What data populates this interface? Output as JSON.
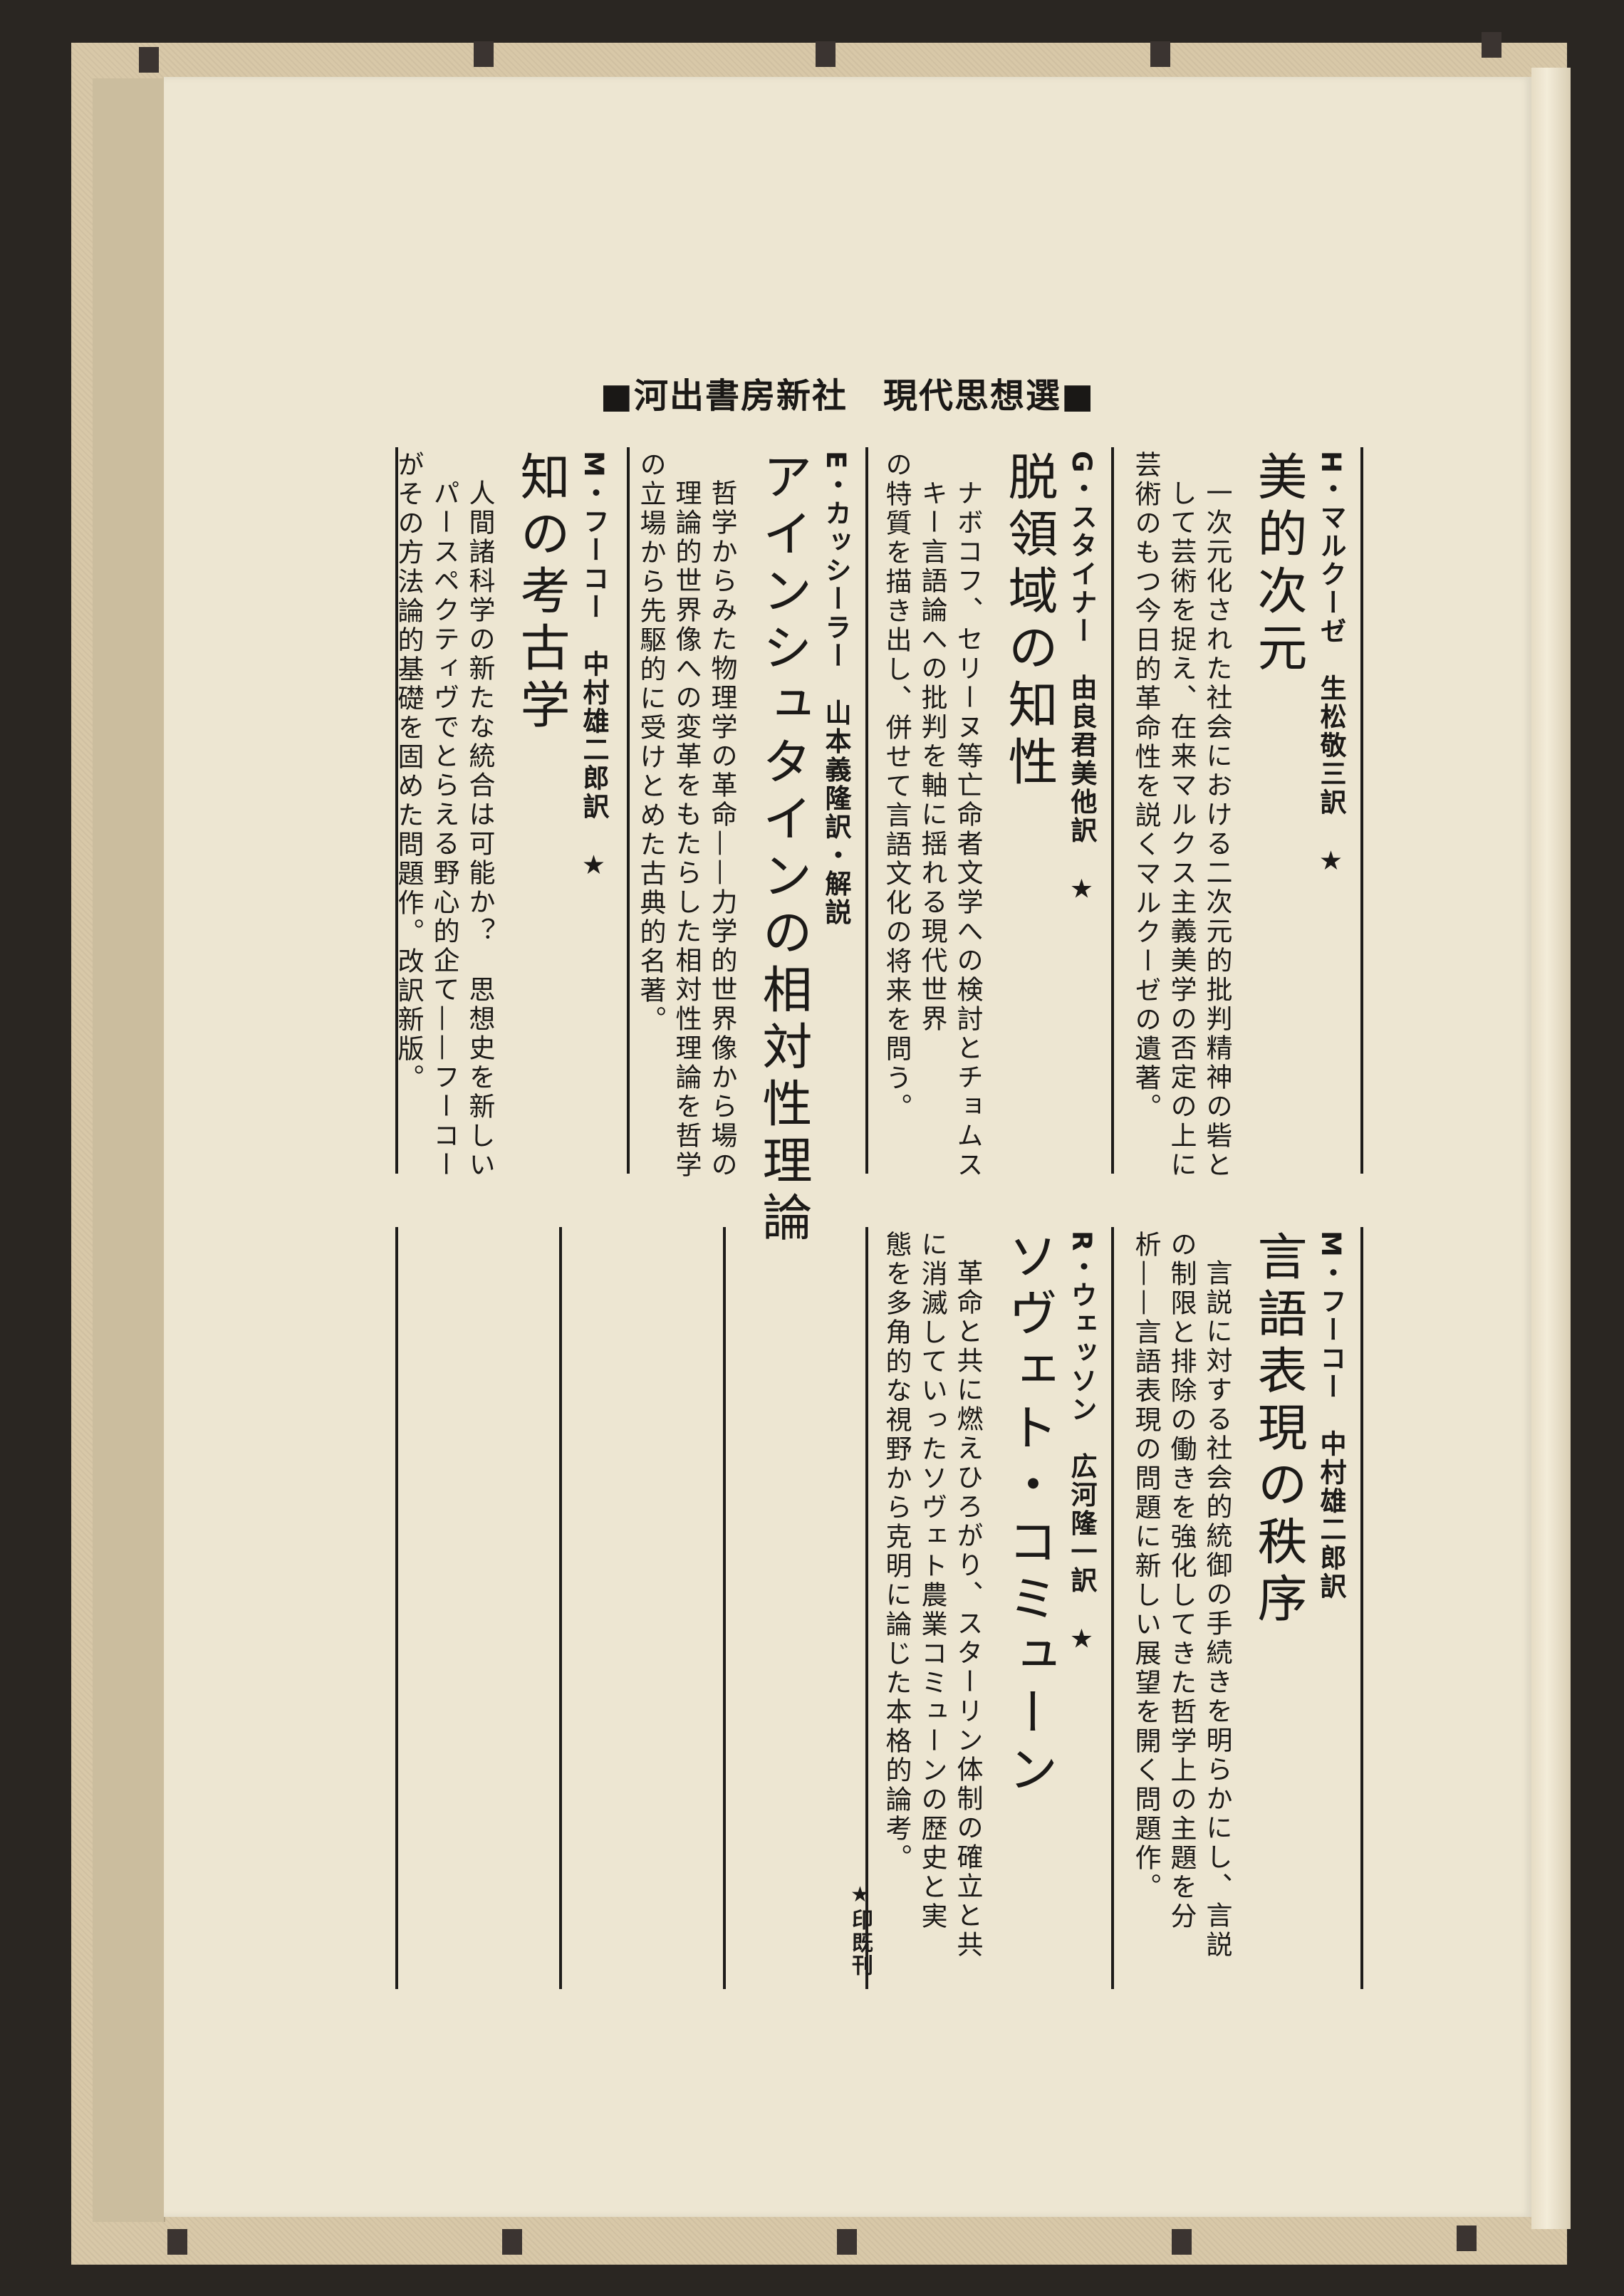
{
  "header": "■河出書房新社　現代思想選■",
  "books": [
    {
      "author": "H・マルクーゼ　生松敬三訳　★",
      "title": "美的次元",
      "desc": [
        "一次元化された社会における二次元的批判精神の砦と",
        "して芸術を捉え、在来マルクス主義美学の否定の上に",
        "芸術のもつ今日的革命性を説くマルクーゼの遺著。"
      ]
    },
    {
      "author": "G・スタイナー　由良君美他訳　★",
      "title": "脱領域の知性",
      "desc": [
        "ナボコフ、セリーヌ等亡命者文学への検討とチョムス",
        "キー言語論への批判を軸に揺れる現代世界",
        "の特質を描き出し、併せて言語文化の将来を問う。"
      ]
    },
    {
      "author": "E・カッシーラー　山本義隆訳・解説",
      "title": "アインシュタインの相対性理論",
      "desc": [
        "哲学からみた物理学の革命——力学的世界像から場の",
        "理論的世界像への変革をもたらした相対性理論を哲学",
        "の立場から先駆的に受けとめた古典的名著。"
      ]
    },
    {
      "author": "M・フーコー　中村雄二郎訳　★",
      "title": "知の考古学",
      "desc": [
        "人間諸科学の新たな統合は可能か？　思想史を新しい",
        "パースペクティヴでとらえる野心的企て——フーコー",
        "がその方法論的基礎を固めた問題作。改訳新版。"
      ]
    },
    {
      "author": "M・フーコー　中村雄二郎訳",
      "title": "言語表現の秩序",
      "desc": [
        "言説に対する社会的統御の手続きを明らかにし、言説",
        "の制限と排除の働きを強化してきた哲学上の主題を分",
        "析——言語表現の問題に新しい展望を開く問題作。"
      ]
    },
    {
      "author": "R・ウェッソン　広河隆一訳　★",
      "title": "ソヴェト・コミューン",
      "desc": [
        "革命と共に燃えひろがり、スターリン体制の確立と共",
        "に消滅していったソヴェト農業コミューンの歴史と実",
        "態を多角的な視野から克明に論じた本格的論考。"
      ]
    }
  ],
  "footnote": "★印既刊"
}
